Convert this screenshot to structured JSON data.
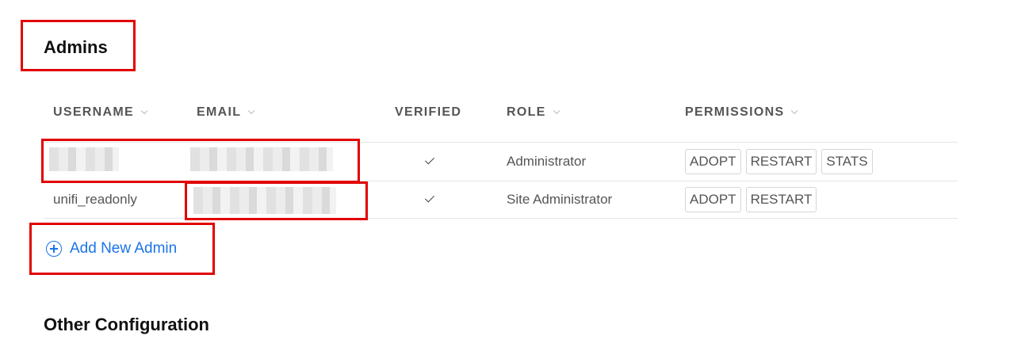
{
  "admins_section": {
    "title": "Admins"
  },
  "table": {
    "columns": [
      {
        "label": "USERNAME",
        "sortable": true
      },
      {
        "label": "EMAIL",
        "sortable": true
      },
      {
        "label": "VERIFIED",
        "sortable": false
      },
      {
        "label": "ROLE",
        "sortable": true
      },
      {
        "label": "PERMISSIONS",
        "sortable": true
      }
    ],
    "rows": [
      {
        "username": "",
        "email": "",
        "verified": true,
        "role": "Administrator",
        "permissions": [
          "ADOPT",
          "RESTART",
          "STATS"
        ]
      },
      {
        "username": "unifi_readonly",
        "email": "",
        "verified": true,
        "role": "Site Administrator",
        "permissions": [
          "ADOPT",
          "RESTART"
        ]
      }
    ]
  },
  "add_admin": {
    "label": "Add New Admin",
    "icon": "plus-circle-icon"
  },
  "other_section": {
    "title": "Other Configuration"
  },
  "colors": {
    "highlight": "#e10000",
    "link": "#1a73e8"
  }
}
